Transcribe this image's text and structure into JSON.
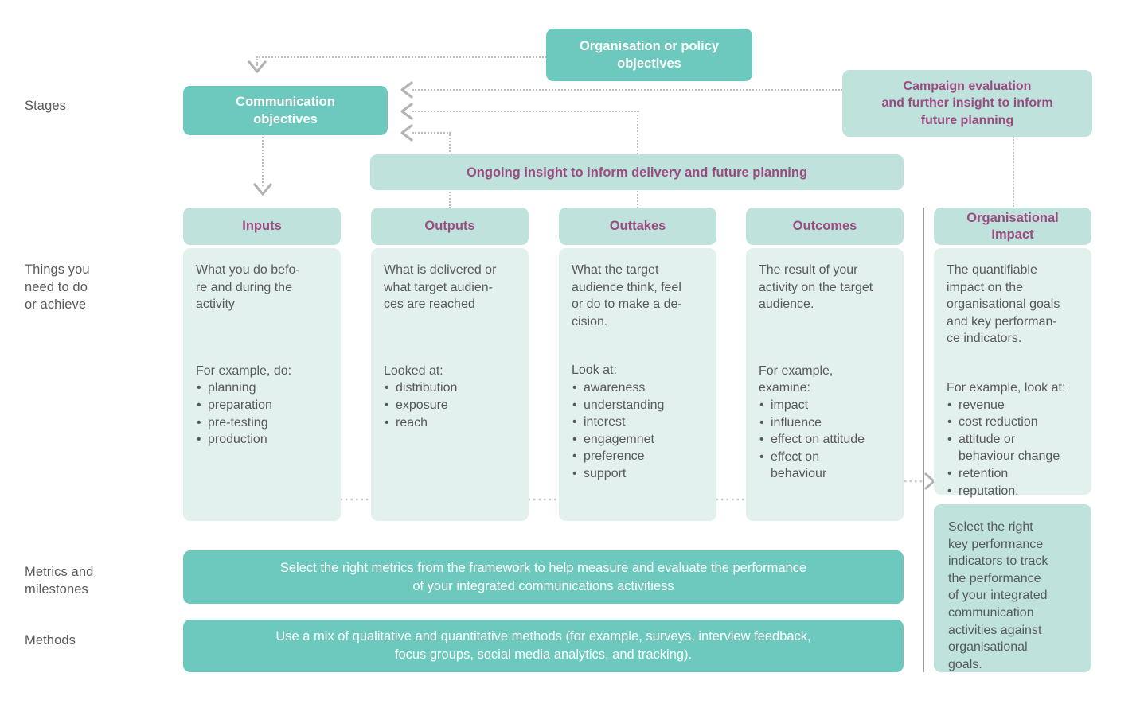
{
  "row_labels": [
    {
      "id": "stages",
      "text": "Stages"
    },
    {
      "id": "things",
      "text": "Things you\nneed to do\nor achieve"
    },
    {
      "id": "metrics",
      "text": "Metrics and\nmilestones"
    },
    {
      "id": "methods",
      "text": "Methods"
    }
  ],
  "top_boxes": {
    "org_objectives": "Organisation or policy\nobjectives",
    "comm_objectives": "Communication\nobjectives",
    "campaign_eval": "Campaign evaluation\nand further insight to inform\nfuture planning",
    "ongoing_insight": "Ongoing insight to inform delivery and future planning"
  },
  "columns": [
    {
      "id": "inputs",
      "header": "Inputs",
      "description": "What you do befo-\nre and during the\nactivity",
      "example_label": "For example, do:",
      "bullets": [
        "planning",
        "preparation",
        "pre-testing",
        "production"
      ]
    },
    {
      "id": "outputs",
      "header": "Outputs",
      "description": "What is delivered or\nwhat target audien-\nces are reached",
      "example_label": "Looked at:",
      "bullets": [
        "distribution",
        "exposure",
        "reach"
      ]
    },
    {
      "id": "outtakes",
      "header": "Outtakes",
      "description": "What the target\naudience think, feel\nor do to make a de-\ncision.",
      "example_label": "Look at:",
      "bullets": [
        "awareness",
        "understanding",
        "interest",
        "engagemnet",
        "preference",
        "support"
      ]
    },
    {
      "id": "outcomes",
      "header": "Outcomes",
      "description": "The result of your\nactivity on the target\naudience.",
      "example_label": "For example,\nexamine:",
      "bullets": [
        "impact",
        "influence",
        "effect on attitude",
        "effect on\n behaviour"
      ]
    },
    {
      "id": "organisational-impact",
      "header": "Organisational\nImpact",
      "description": "The quantifiable\nimpact on the\norganisational goals\nand key performan-\nce indicators.",
      "example_label": "For example, look at:",
      "bullets": [
        "revenue",
        "cost reduction",
        "attitude or\n behaviour change",
        "retention",
        "reputation."
      ]
    }
  ],
  "banners": {
    "metrics": "Select the right metrics from the framework to help measure and evaluate the performance\nof your integrated communications activitiess",
    "methods": "Use a mix of qualitative and quantitative methods (for example, surveys, interview feedback,\nfocus groups, social media analytics, and tracking)."
  },
  "side_note": "Select the right\nkey performance\nindicators to track\nthe performance\nof your integrated\ncommunication\nactivities against\norganisational\ngoals.",
  "colors": {
    "teal_solid": "#6dc9bd",
    "mint": "#bfe3dc",
    "pale_mint": "#e3f1ee",
    "purple_text": "#9c4a82",
    "grey_text": "#58595b",
    "dotted_grey": "#bdbdbd"
  }
}
